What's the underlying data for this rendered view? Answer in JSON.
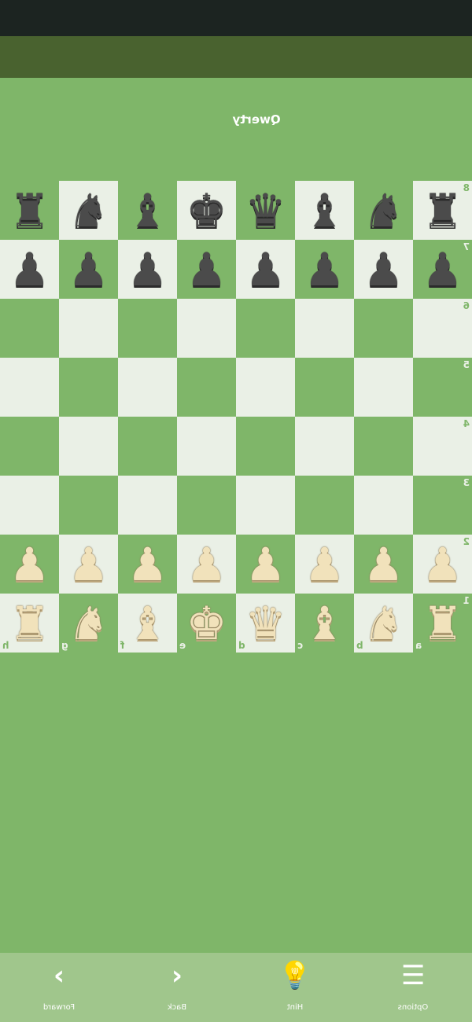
{
  "player": {
    "name": "Qwerty"
  },
  "board": {
    "light_color": "#eaf0e6",
    "dark_color": "#7fb669",
    "files": [
      "a",
      "b",
      "c",
      "d",
      "e",
      "f",
      "g",
      "h"
    ],
    "ranks": [
      "8",
      "7",
      "6",
      "5",
      "4",
      "3",
      "2",
      "1"
    ],
    "position": [
      [
        "r",
        "n",
        "b",
        "q",
        "k",
        "b",
        "n",
        "r"
      ],
      [
        "p",
        "p",
        "p",
        "p",
        "p",
        "p",
        "p",
        "p"
      ],
      [
        "",
        "",
        "",
        "",
        "",
        "",
        "",
        ""
      ],
      [
        "",
        "",
        "",
        "",
        "",
        "",
        "",
        ""
      ],
      [
        "",
        "",
        "",
        "",
        "",
        "",
        "",
        ""
      ],
      [
        "",
        "",
        "",
        "",
        "",
        "",
        "",
        ""
      ],
      [
        "P",
        "P",
        "P",
        "P",
        "P",
        "P",
        "P",
        "P"
      ],
      [
        "R",
        "N",
        "B",
        "Q",
        "K",
        "B",
        "N",
        "R"
      ]
    ]
  },
  "toolbar": {
    "options_label": "Options",
    "hint_label": "Hint",
    "back_label": "Back",
    "forward_label": "Forward",
    "options_icon": "menu-icon",
    "hint_icon": "lightbulb-icon",
    "back_icon": "chevron-left-icon",
    "forward_icon": "chevron-right-icon"
  }
}
